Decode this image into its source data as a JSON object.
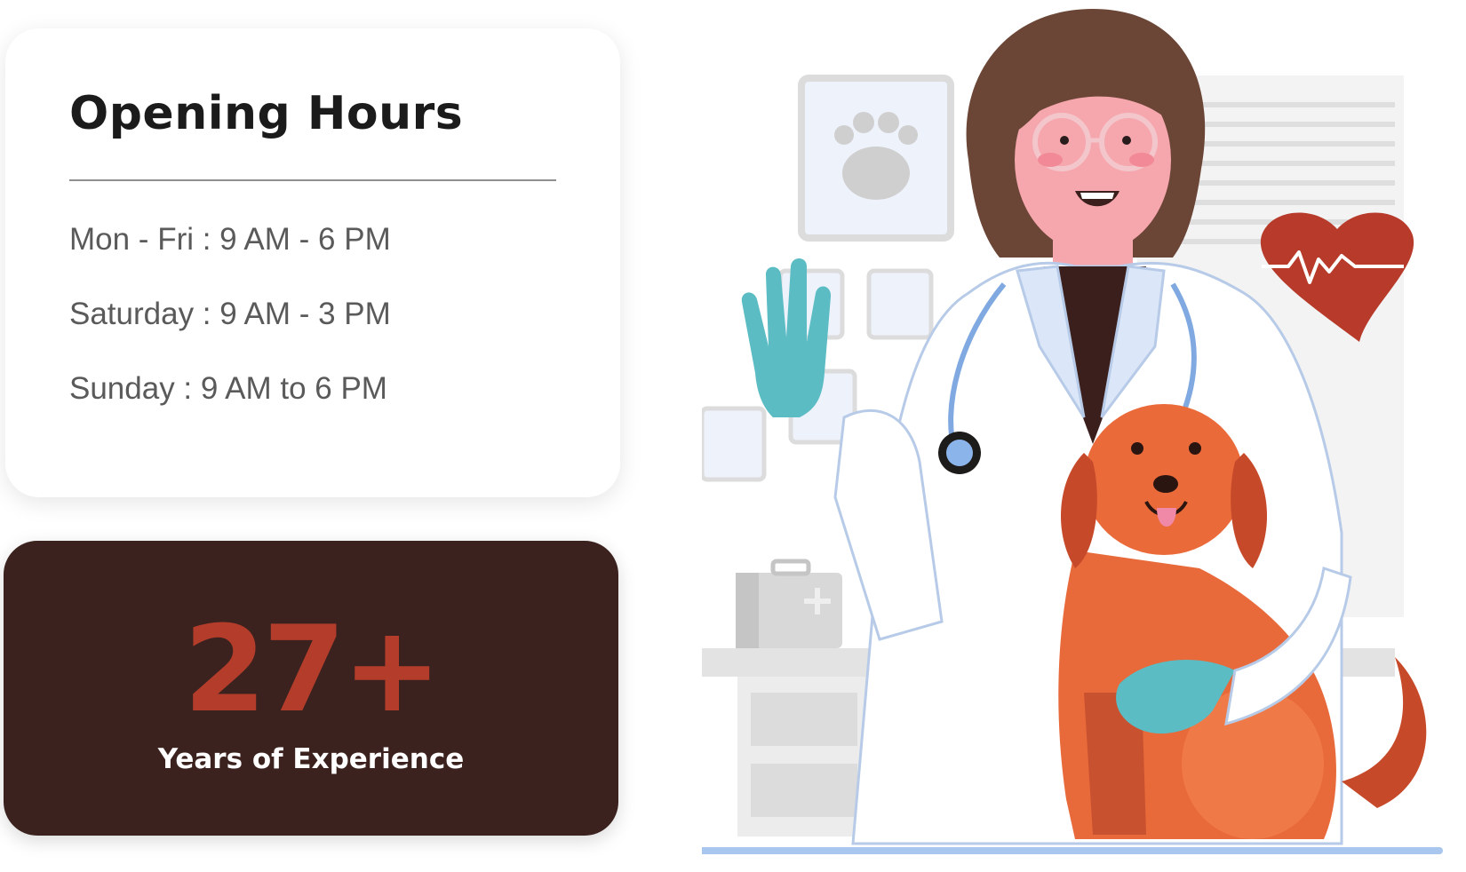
{
  "opening_hours": {
    "title": "Opening Hours",
    "rows": [
      "Mon - Fri : 9 AM - 6 PM",
      "Saturday : 9 AM - 3 PM",
      "Sunday : 9 AM to 6 PM"
    ]
  },
  "experience": {
    "number": "27+",
    "label": "Years of Experience"
  },
  "illustration": {
    "icons": [
      "veterinarian-illustration",
      "dog-illustration",
      "heart-pulse-icon",
      "paw-print-icon",
      "medical-kit-icon"
    ],
    "colors": {
      "accent": "#b43c2a",
      "dark_card": "#3b221f",
      "glove": "#5bbcc4",
      "dog": "#e8693a",
      "heart": "#b73a2a"
    }
  }
}
